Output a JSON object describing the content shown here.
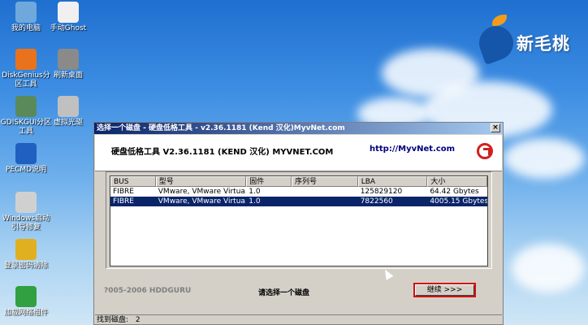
{
  "desktop": {
    "logo_text": "新毛桃",
    "icons": [
      {
        "label": "我的电脑",
        "icon": "computer-icon",
        "color": "#6fa8dc"
      },
      {
        "label": "手动Ghost",
        "icon": "ghost-icon",
        "color": "#f0f0f0"
      },
      {
        "label": "DiskGenius分区工具",
        "icon": "diskgenius-icon",
        "color": "#e8731c"
      },
      {
        "label": "刷新桌面",
        "icon": "refresh-desktop-icon",
        "color": "#8a8a8a"
      },
      {
        "label": "GDISKGUI分区工具",
        "icon": "partition-icon",
        "color": "#5a8a5a"
      },
      {
        "label": "虚拟光驱",
        "icon": "virtual-drive-icon",
        "color": "#c0c0c0"
      },
      {
        "label": "PECMD说明",
        "icon": "help-icon",
        "color": "#2060c0"
      },
      {
        "label": "Windows启动引导修复",
        "icon": "boot-repair-icon",
        "color": "#d0d0d0"
      },
      {
        "label": "登录密码清除",
        "icon": "key-icon",
        "color": "#e0b020"
      },
      {
        "label": "加载网络组件",
        "icon": "network-icon",
        "color": "#30a040"
      }
    ]
  },
  "window": {
    "title": "选择一个磁盘 - 硬盘低格工具 - v2.36.1181 (Kend 汉化)MyvNet.com",
    "close_label": "×",
    "header_title": "硬盘低格工具 V2.36.1181 (KEND 汉化) MYVNET.COM",
    "header_url": "http://MyvNet.com",
    "columns": [
      "BUS",
      "型号",
      "固件",
      "序列号",
      "LBA",
      "大小"
    ],
    "rows": [
      [
        "FIBRE",
        "VMware, VMware Virtua...",
        "1.0",
        "",
        "125829120",
        "64.42 Gbytes"
      ],
      [
        "FIBRE",
        "VMware, VMware Virtua...",
        "1.0",
        "",
        "7822560",
        "4005.15 Gbytes"
      ]
    ],
    "selected_row": 1,
    "copyright": "?005-2006 HDDGURU",
    "prompt": "请选择一个磁盘",
    "continue_label": "继续 >>>",
    "status_label": "找到磁盘:",
    "status_count": "2"
  }
}
